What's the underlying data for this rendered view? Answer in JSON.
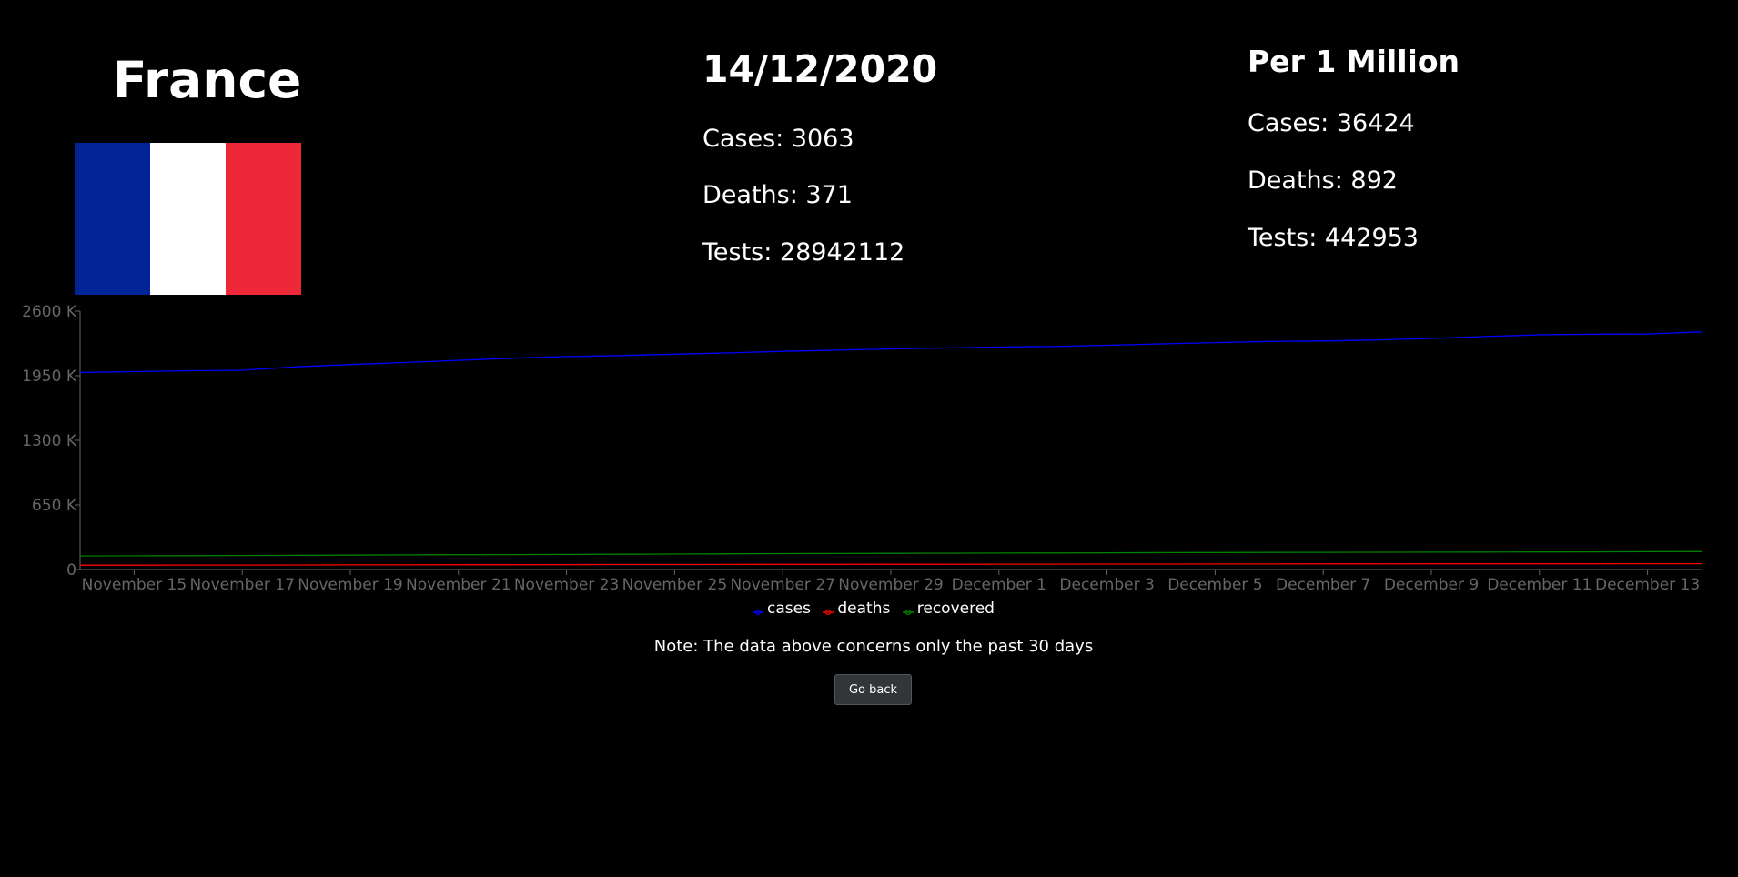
{
  "country": {
    "name": "France",
    "flag_colors": [
      "#002395",
      "#ffffff",
      "#ed2939"
    ]
  },
  "summary": {
    "date": "14/12/2020",
    "cases_label": "Cases: 3063",
    "deaths_label": "Deaths: 371",
    "tests_label": "Tests: 28942112"
  },
  "per_million": {
    "title": "Per 1 Million",
    "cases_label": "Cases: 36424",
    "deaths_label": "Deaths: 892",
    "tests_label": "Tests: 442953"
  },
  "chart_data": {
    "type": "line",
    "x": [
      "November 14",
      "November 15",
      "November 16",
      "November 17",
      "November 18",
      "November 19",
      "November 20",
      "November 21",
      "November 22",
      "November 23",
      "November 24",
      "November 25",
      "November 26",
      "November 27",
      "November 28",
      "November 29",
      "November 30",
      "December 1",
      "December 2",
      "December 3",
      "December 4",
      "December 5",
      "December 6",
      "December 7",
      "December 8",
      "December 9",
      "December 10",
      "December 11",
      "December 12",
      "December 13",
      "December 14"
    ],
    "x_tick_labels": [
      "November 15",
      "November 17",
      "November 19",
      "November 21",
      "November 23",
      "November 25",
      "November 27",
      "November 29",
      "December 1",
      "December 3",
      "December 5",
      "December 7",
      "December 9",
      "December 11",
      "December 13"
    ],
    "y_ticks": [
      "0",
      "650 K",
      "1300 K",
      "1950 K",
      "2600 K"
    ],
    "ylim": [
      0,
      2600000
    ],
    "series": [
      {
        "name": "cases",
        "color": "#0000ff",
        "values": [
          1981827,
          1991233,
          2000000,
          2005000,
          2040000,
          2063000,
          2083000,
          2105000,
          2127000,
          2143000,
          2153000,
          2167000,
          2180000,
          2195000,
          2207000,
          2220000,
          2229000,
          2238000,
          2245000,
          2257000,
          2270000,
          2283000,
          2295000,
          2300000,
          2310000,
          2325000,
          2345000,
          2362000,
          2368000,
          2370000,
          2391000
        ]
      },
      {
        "name": "deaths",
        "color": "#ff0000",
        "values": [
          43892,
          44246,
          44548,
          45054,
          45881,
          46273,
          47127,
          48265,
          48732,
          49232,
          50237,
          50618,
          51041,
          51914,
          52127,
          52731,
          53506,
          53878,
          54140,
          54767,
          55155,
          55521,
          55613,
          56352,
          56940,
          57567,
          57911,
          58015,
          58015,
          58391,
          58391
        ]
      },
      {
        "name": "recovered",
        "color": "#008000",
        "values": [
          136000,
          138000,
          139000,
          141000,
          143000,
          145000,
          147000,
          149000,
          150000,
          152000,
          154000,
          156000,
          158000,
          160000,
          161000,
          163000,
          164000,
          166000,
          167000,
          168000,
          170000,
          171000,
          172000,
          173000,
          174000,
          175000,
          176000,
          177000,
          178000,
          179000,
          180000
        ]
      }
    ]
  },
  "legend": {
    "cases": "cases",
    "deaths": "deaths",
    "recovered": "recovered"
  },
  "note": "Note: The data above concerns only the past 30 days",
  "go_back_label": "Go back"
}
